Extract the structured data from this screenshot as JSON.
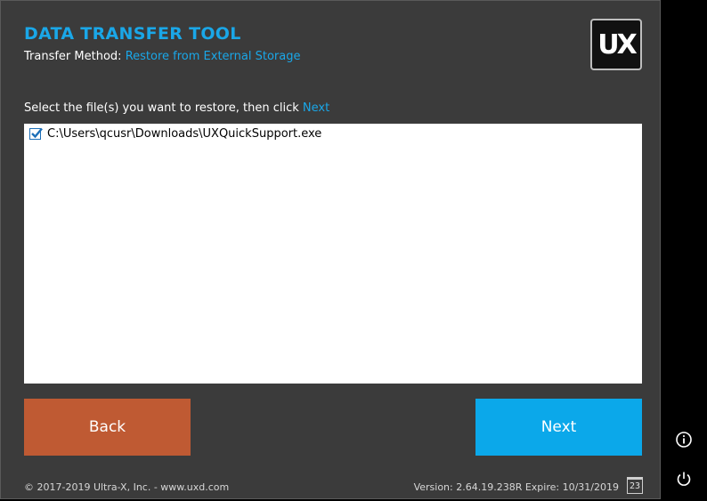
{
  "header": {
    "title": "DATA TRANSFER TOOL",
    "method_label": "Transfer Method:",
    "method_value": "Restore from External Storage",
    "logo_text": "UX"
  },
  "instruction": {
    "text": "Select the file(s) you want to restore, then click",
    "link": "Next"
  },
  "files": [
    {
      "path": "C:\\Users\\qcusr\\Downloads\\UXQuickSupport.exe",
      "checked": true
    }
  ],
  "buttons": {
    "back": "Back",
    "next": "Next"
  },
  "footer": {
    "copyright": "© 2017-2019 Ultra-X, Inc. - www.uxd.com",
    "version": "Version: 2.64.19.238R Expire: 10/31/2019",
    "calendar_day": "23"
  },
  "side": {
    "info_icon": "info-icon",
    "power_icon": "power-icon"
  },
  "colors": {
    "accent": "#1aa7e8",
    "back_button": "#bf5a33",
    "next_button": "#0ba8ea",
    "background": "#3b3b3b"
  }
}
